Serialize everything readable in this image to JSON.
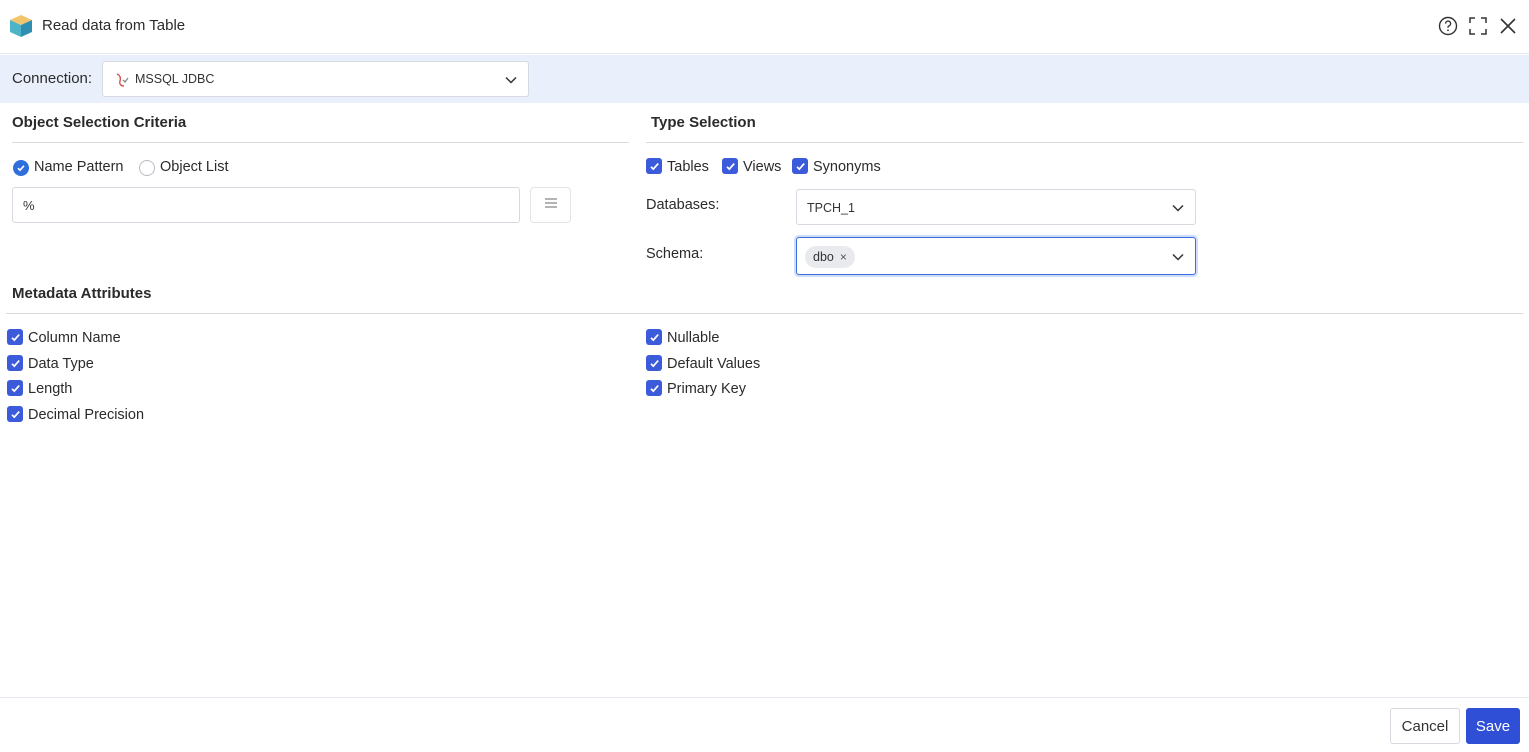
{
  "window": {
    "title": "Read data from Table",
    "icons": [
      "help-icon",
      "maximize-icon",
      "close-icon"
    ]
  },
  "connection": {
    "label": "Connection:",
    "value": "MSSQL JDBC",
    "icon": "database-connector-icon"
  },
  "object_selection": {
    "title": "Object Selection Criteria",
    "radios": [
      {
        "label": "Name Pattern",
        "checked": true
      },
      {
        "label": "Object List",
        "checked": false
      }
    ],
    "pattern_value": "%"
  },
  "type_selection": {
    "title": "Type Selection",
    "checkboxes": [
      {
        "label": "Tables",
        "checked": true
      },
      {
        "label": "Views",
        "checked": true
      },
      {
        "label": "Synonyms",
        "checked": true
      }
    ],
    "databases_label": "Databases:",
    "databases_value": "TPCH_1",
    "schema_label": "Schema:",
    "schema_tags": [
      "dbo"
    ],
    "tag_remove_glyph": "×"
  },
  "metadata": {
    "title": "Metadata Attributes",
    "left": [
      {
        "label": "Column Name",
        "checked": true
      },
      {
        "label": "Data Type",
        "checked": true
      },
      {
        "label": "Length",
        "checked": true
      },
      {
        "label": "Decimal Precision",
        "checked": true
      }
    ],
    "right": [
      {
        "label": "Nullable",
        "checked": true
      },
      {
        "label": "Default Values",
        "checked": true
      },
      {
        "label": "Primary Key",
        "checked": true
      }
    ]
  },
  "footer": {
    "cancel": "Cancel",
    "save": "Save"
  },
  "colors": {
    "accent": "#2f4fd6",
    "checkbox": "#3b5bdb",
    "connection_bar": "#e9effb"
  }
}
